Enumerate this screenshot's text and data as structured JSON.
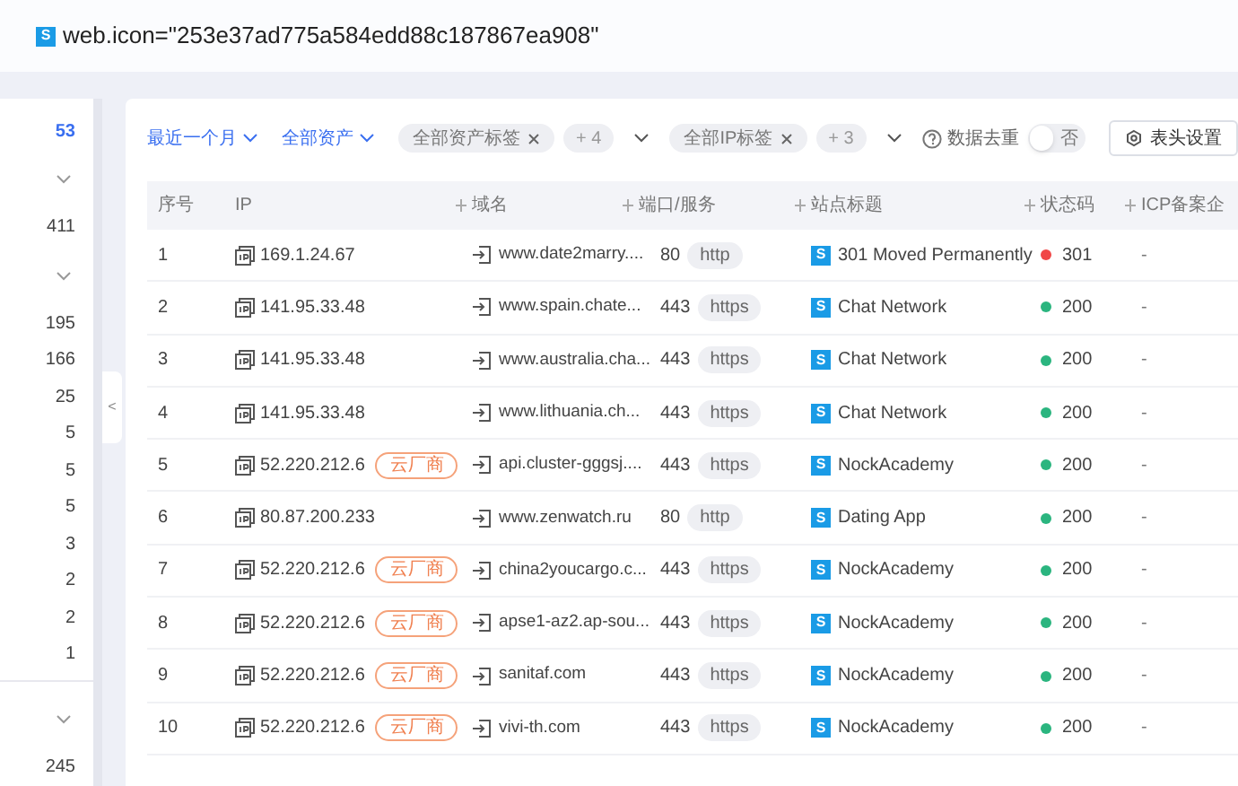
{
  "query": {
    "icon_letter": "S",
    "text": "web.icon=\"253e37ad775a584edd88c187867ea908\""
  },
  "sidebar": {
    "items": [
      {
        "kind": "count",
        "count": "53",
        "selected": true
      },
      {
        "kind": "toggle",
        "expanded": true
      },
      {
        "kind": "count",
        "count": "411",
        "selected": false
      },
      {
        "kind": "toggle",
        "expanded": true
      },
      {
        "kind": "count",
        "count": "195",
        "selected": false
      },
      {
        "kind": "count",
        "count": "166",
        "selected": false
      },
      {
        "kind": "count",
        "count": "25",
        "selected": false
      },
      {
        "kind": "count",
        "count": "5",
        "selected": false
      },
      {
        "kind": "count",
        "count": "5",
        "selected": false
      },
      {
        "kind": "count",
        "count": "5",
        "selected": false
      },
      {
        "kind": "count",
        "count": "3",
        "selected": false
      },
      {
        "kind": "count",
        "count": "2",
        "selected": false
      },
      {
        "kind": "count",
        "count": "2",
        "selected": false
      },
      {
        "kind": "count",
        "count": "1",
        "selected": false
      },
      {
        "kind": "divider"
      },
      {
        "kind": "toggle",
        "expanded": true
      },
      {
        "kind": "count",
        "count": "245",
        "selected": false
      }
    ]
  },
  "collapse_handle": {
    "label": "<"
  },
  "filters": {
    "time": "最近一个月",
    "assets": "全部资产",
    "asset_tags": {
      "tag": "全部资产标签",
      "more": "+ 4"
    },
    "ip_tags": {
      "tag": "全部IP标签",
      "more": "+ 3"
    },
    "dedupe": {
      "label": "数据去重",
      "on": false,
      "state_label": "否"
    },
    "columns_button": "表头设置"
  },
  "table": {
    "columns": [
      {
        "label": "序号",
        "sortable": false
      },
      {
        "label": "IP",
        "sortable": false
      },
      {
        "label": "域名",
        "sortable": true
      },
      {
        "label": "端口/服务",
        "sortable": true
      },
      {
        "label": "站点标题",
        "sortable": true
      },
      {
        "label": "状态码",
        "sortable": true
      },
      {
        "label": "ICP备案企",
        "sortable": true
      }
    ],
    "rows": [
      {
        "no": "1",
        "ip": "169.1.24.67",
        "cloud_tag": null,
        "domain": "www.date2marry....",
        "port": "80",
        "service": "http",
        "title_icon": "S",
        "title": "301 Moved Permanently",
        "color": "#f04747",
        "status": "301",
        "icp": "-"
      },
      {
        "no": "2",
        "ip": "141.95.33.48",
        "cloud_tag": null,
        "domain": "www.spain.chate...",
        "port": "443",
        "service": "https",
        "title_icon": "S",
        "title": "Chat Network",
        "color": "#2bb57f",
        "status": "200",
        "icp": "-"
      },
      {
        "no": "3",
        "ip": "141.95.33.48",
        "cloud_tag": null,
        "domain": "www.australia.cha...",
        "port": "443",
        "service": "https",
        "title_icon": "S",
        "title": "Chat Network",
        "color": "#2bb57f",
        "status": "200",
        "icp": "-"
      },
      {
        "no": "4",
        "ip": "141.95.33.48",
        "cloud_tag": null,
        "domain": "www.lithuania.ch...",
        "port": "443",
        "service": "https",
        "title_icon": "S",
        "title": "Chat Network",
        "color": "#2bb57f",
        "status": "200",
        "icp": "-"
      },
      {
        "no": "5",
        "ip": "52.220.212.6",
        "cloud_tag": "云厂商",
        "domain": "api.cluster-gggsj....",
        "port": "443",
        "service": "https",
        "title_icon": "S",
        "title": "NockAcademy",
        "color": "#2bb57f",
        "status": "200",
        "icp": "-"
      },
      {
        "no": "6",
        "ip": "80.87.200.233",
        "cloud_tag": null,
        "domain": "www.zenwatch.ru",
        "port": "80",
        "service": "http",
        "title_icon": "S",
        "title": "Dating App",
        "color": "#2bb57f",
        "status": "200",
        "icp": "-"
      },
      {
        "no": "7",
        "ip": "52.220.212.6",
        "cloud_tag": "云厂商",
        "domain": "china2youcargo.c...",
        "port": "443",
        "service": "https",
        "title_icon": "S",
        "title": "NockAcademy",
        "color": "#2bb57f",
        "status": "200",
        "icp": "-"
      },
      {
        "no": "8",
        "ip": "52.220.212.6",
        "cloud_tag": "云厂商",
        "domain": "apse1-az2.ap-sou...",
        "port": "443",
        "service": "https",
        "title_icon": "S",
        "title": "NockAcademy",
        "color": "#2bb57f",
        "status": "200",
        "icp": "-"
      },
      {
        "no": "9",
        "ip": "52.220.212.6",
        "cloud_tag": "云厂商",
        "domain": "sanitaf.com",
        "port": "443",
        "service": "https",
        "title_icon": "S",
        "title": "NockAcademy",
        "color": "#2bb57f",
        "status": "200",
        "icp": "-"
      },
      {
        "no": "10",
        "ip": "52.220.212.6",
        "cloud_tag": "云厂商",
        "domain": "vivi-th.com",
        "port": "443",
        "service": "https",
        "title_icon": "S",
        "title": "NockAcademy",
        "color": "#2bb57f",
        "status": "200",
        "icp": "-"
      }
    ]
  }
}
